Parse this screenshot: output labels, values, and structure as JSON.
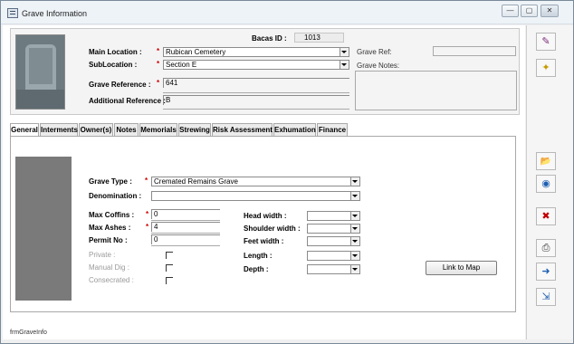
{
  "window": {
    "title": "Grave Information",
    "minimize_glyph": "—",
    "maximize_glyph": "▢",
    "close_glyph": "✕"
  },
  "header": {
    "bacas_id_label": "Bacas ID :",
    "bacas_id_value": "1013",
    "main_location_label": "Main Location :",
    "main_location_value": "Rubican Cemetery",
    "sublocation_label": "SubLocation :",
    "sublocation_value": "Section E",
    "grave_reference_label": "Grave Reference :",
    "grave_reference_value": "641",
    "additional_reference_label": "Additional Reference :",
    "additional_reference_value": "B",
    "grave_ref_label": "Grave Ref:",
    "grave_ref_value": "",
    "grave_notes_label": "Grave Notes:",
    "grave_notes_value": "",
    "required_marker": "*"
  },
  "tabs": [
    {
      "label": "General",
      "active": true
    },
    {
      "label": "Interments",
      "active": false
    },
    {
      "label": "Owner(s)",
      "active": false
    },
    {
      "label": "Notes",
      "active": false
    },
    {
      "label": "Memorials",
      "active": false
    },
    {
      "label": "Strewing",
      "active": false
    },
    {
      "label": "Risk Assessment",
      "active": false
    },
    {
      "label": "Exhumation",
      "active": false
    },
    {
      "label": "Finance",
      "active": false
    }
  ],
  "general": {
    "grave_type_label": "Grave Type :",
    "grave_type_value": "Cremated Remains Grave",
    "denomination_label": "Denomination :",
    "denomination_value": "",
    "max_coffins_label": "Max Coffins :",
    "max_coffins_value": "0",
    "max_ashes_label": "Max Ashes :",
    "max_ashes_value": "4",
    "permit_no_label": "Permit No :",
    "permit_no_value": "0",
    "private_label": "Private :",
    "manual_dig_label": "Manual Dig :",
    "consecrated_label": "Consecrated :",
    "private_checked": false,
    "manual_dig_checked": false,
    "consecrated_checked": false,
    "head_width_label": "Head width :",
    "shoulder_width_label": "Shoulder width :",
    "feet_width_label": "Feet width :",
    "length_label": "Length :",
    "depth_label": "Depth :",
    "head_width_value": "",
    "shoulder_width_value": "",
    "feet_width_value": "",
    "length_value": "",
    "depth_value": "",
    "link_to_map_label": "Link to Map"
  },
  "sidebar": {
    "buttons": [
      {
        "name": "edit-icon",
        "glyph": "✎"
      },
      {
        "name": "new-record-icon",
        "glyph": "✦"
      },
      {
        "name": "open-folder-icon",
        "glyph": "📂"
      },
      {
        "name": "globe-icon",
        "glyph": "◉"
      },
      {
        "name": "delete-icon",
        "glyph": "✖"
      },
      {
        "name": "print-icon",
        "glyph": "⎙"
      },
      {
        "name": "export-icon",
        "glyph": "➜"
      },
      {
        "name": "exit-icon",
        "glyph": "⇲"
      }
    ]
  },
  "footer": {
    "form_name": "frmGraveInfo"
  },
  "colors": {
    "required": "#d00000",
    "disabled_text": "#9a9a9a",
    "dark_panel": "#7a7a7a",
    "delete_icon": "#c00000",
    "folder_icon": "#e0a800",
    "globe_icon": "#1e5fb0"
  }
}
